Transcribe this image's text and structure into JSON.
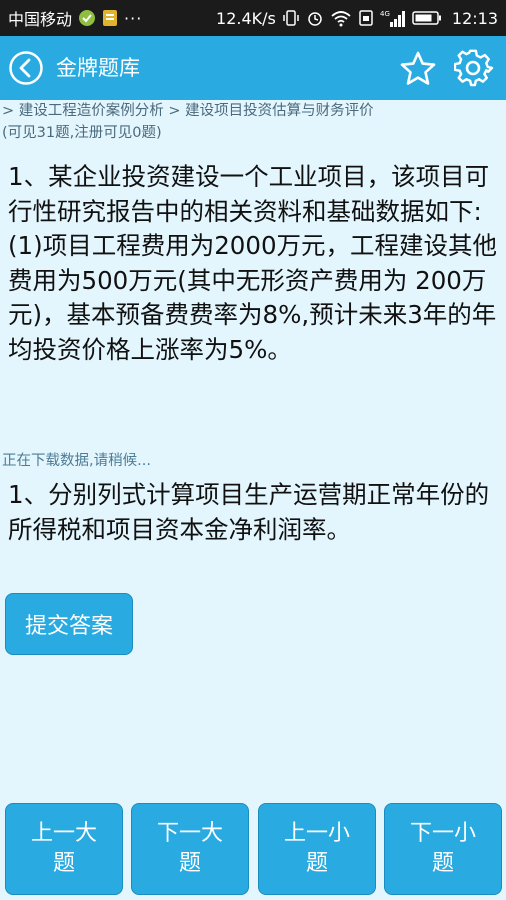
{
  "status_bar": {
    "carrier": "中国移动",
    "dots": "···",
    "speed": "12.4K/s",
    "network": "4G",
    "time": "12:13"
  },
  "app_bar": {
    "title": "金牌题库"
  },
  "breadcrumb": {
    "text": "> 建设工程造价案例分析 > 建设项目投资估算与财务评价",
    "visibility_note": "(可见31题,注册可见0题)"
  },
  "question": {
    "text": "1、某企业投资建设一个工业项目，该项目可行性研究报告中的相关资料和基础数据如下:\n(1)项目工程费用为2000万元，工程建设其他费用为500万元(其中无形资产费用为 200万元)，基本预备费费率为8%,预计未来3年的年均投资价格上涨率为5%。"
  },
  "loading_text": "正在下载数据,请稍候...",
  "subquestion": {
    "text": "1、分别列式计算项目生产运营期正常年份的所得税和项目资本金净利润率。"
  },
  "submit_label": "提交答案",
  "nav": {
    "prev_big": "上一大题",
    "next_big": "下一大题",
    "prev_small": "上一小题",
    "next_small": "下一小题"
  },
  "colors": {
    "accent": "#29abe2",
    "background": "#e4f6fd",
    "status_bar": "#1b1b1b"
  }
}
